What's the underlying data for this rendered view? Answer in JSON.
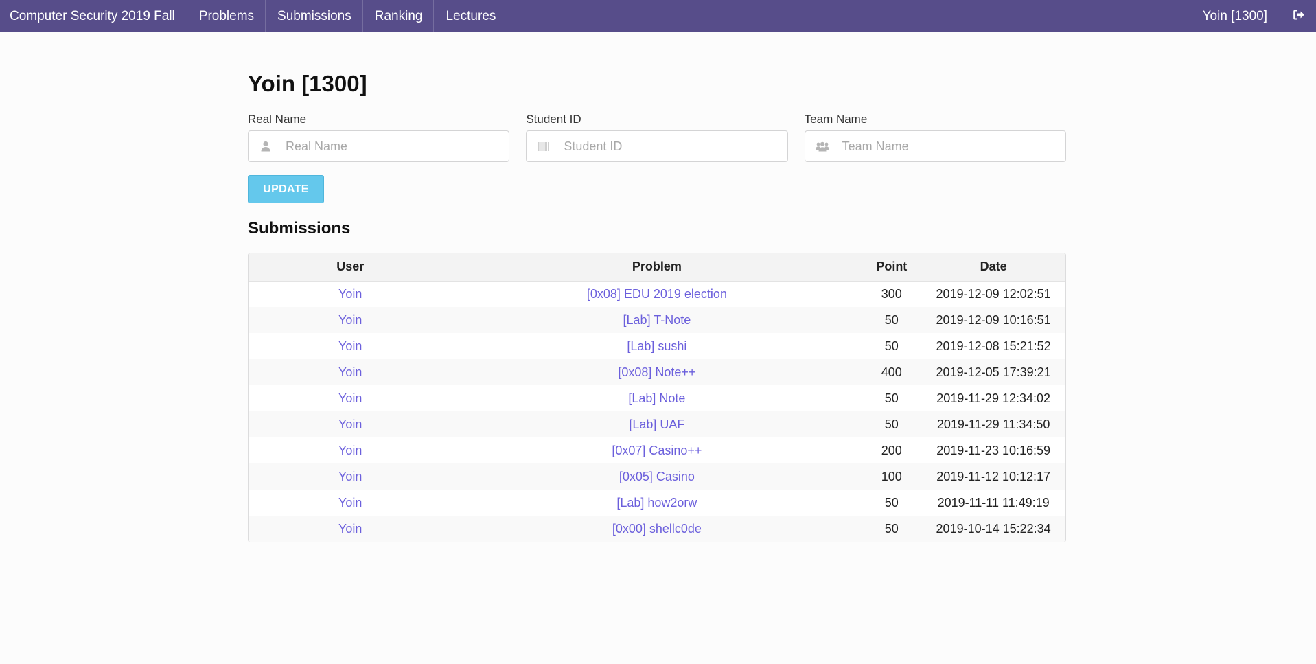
{
  "nav": {
    "brand": "Computer Security 2019 Fall",
    "items": [
      {
        "label": "Problems"
      },
      {
        "label": "Submissions"
      },
      {
        "label": "Ranking"
      },
      {
        "label": "Lectures"
      }
    ],
    "user": "Yoin [1300]",
    "logout_icon": "sign-out-icon"
  },
  "profile": {
    "title": "Yoin [1300]",
    "fields": {
      "real_name": {
        "label": "Real Name",
        "placeholder": "Real Name",
        "value": "",
        "icon": "user-icon"
      },
      "student_id": {
        "label": "Student ID",
        "placeholder": "Student ID",
        "value": "",
        "icon": "barcode-icon"
      },
      "team_name": {
        "label": "Team Name",
        "placeholder": "Team Name",
        "value": "",
        "icon": "users-icon"
      }
    },
    "update_label": "UPDATE"
  },
  "submissions": {
    "title": "Submissions",
    "columns": [
      "User",
      "Problem",
      "Point",
      "Date"
    ],
    "rows": [
      {
        "user": "Yoin",
        "problem": "[0x08] EDU 2019 election",
        "point": "300",
        "date": "2019-12-09 12:02:51"
      },
      {
        "user": "Yoin",
        "problem": "[Lab] T-Note",
        "point": "50",
        "date": "2019-12-09 10:16:51"
      },
      {
        "user": "Yoin",
        "problem": "[Lab] sushi",
        "point": "50",
        "date": "2019-12-08 15:21:52"
      },
      {
        "user": "Yoin",
        "problem": "[0x08] Note++",
        "point": "400",
        "date": "2019-12-05 17:39:21"
      },
      {
        "user": "Yoin",
        "problem": "[Lab] Note",
        "point": "50",
        "date": "2019-11-29 12:34:02"
      },
      {
        "user": "Yoin",
        "problem": "[Lab] UAF",
        "point": "50",
        "date": "2019-11-29 11:34:50"
      },
      {
        "user": "Yoin",
        "problem": "[0x07] Casino++",
        "point": "200",
        "date": "2019-11-23 10:16:59"
      },
      {
        "user": "Yoin",
        "problem": "[0x05] Casino",
        "point": "100",
        "date": "2019-11-12 10:12:17"
      },
      {
        "user": "Yoin",
        "problem": "[Lab] how2orw",
        "point": "50",
        "date": "2019-11-11 11:49:19"
      },
      {
        "user": "Yoin",
        "problem": "[0x00] shellc0de",
        "point": "50",
        "date": "2019-10-14 15:22:34"
      }
    ]
  },
  "colors": {
    "navbar": "#574d8a",
    "link": "#6b5fdc",
    "button": "#64c8ec"
  }
}
